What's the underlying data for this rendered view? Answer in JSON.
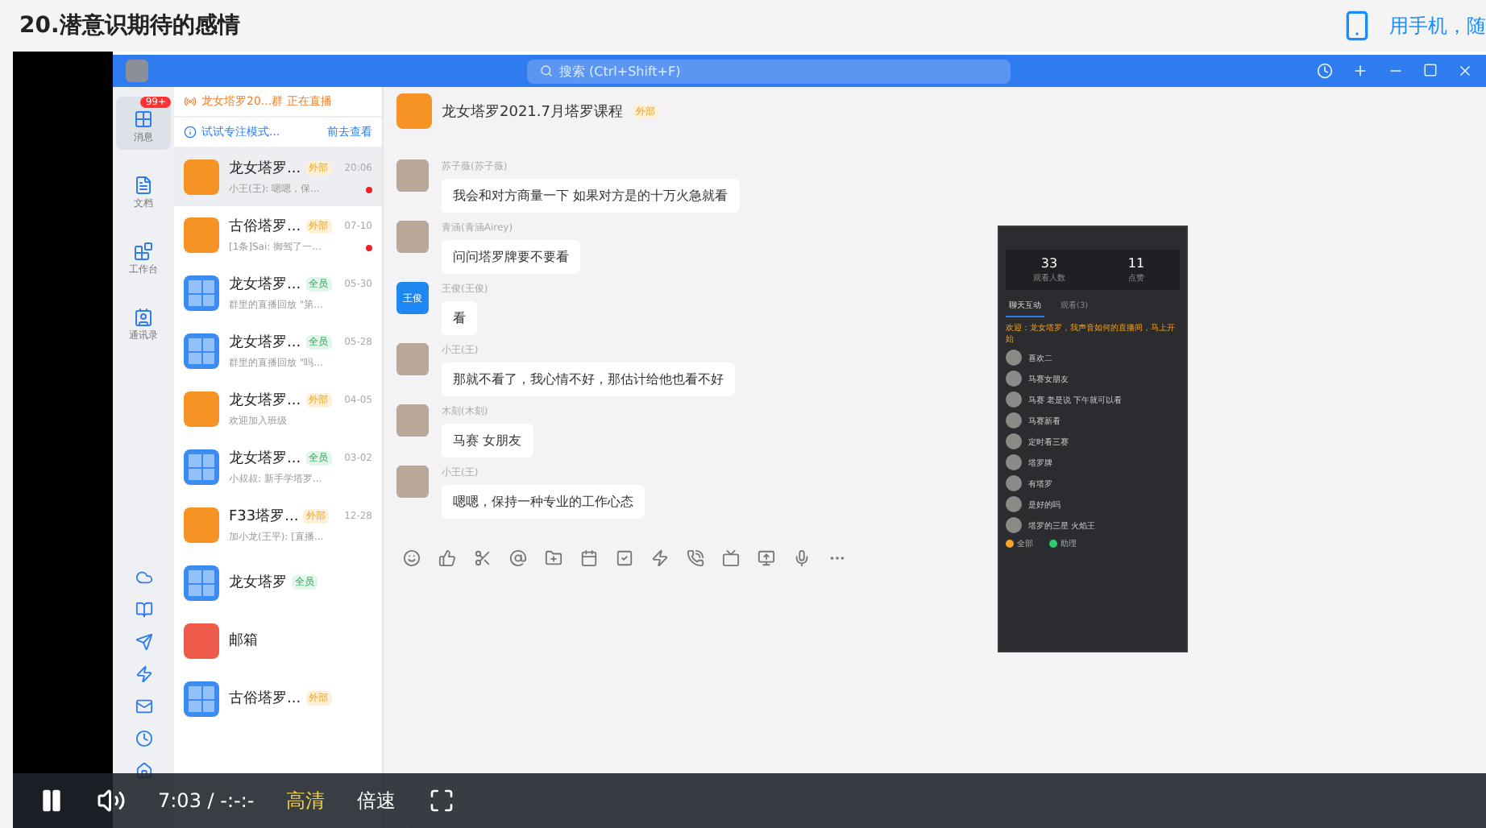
{
  "page_title": "20.潜意识期待的感情",
  "mobile_hint": "用手机，随",
  "app": {
    "search_placeholder": "搜索 (Ctrl+Shift+F)",
    "rail": [
      {
        "label": "消息",
        "badge": "99+",
        "selected": true
      },
      {
        "label": "文档",
        "selected": false
      },
      {
        "label": "工作台",
        "selected": false
      },
      {
        "label": "通讯录",
        "selected": false
      }
    ],
    "banners": [
      {
        "kind": "live",
        "text": "龙女塔罗20...群 正在直播"
      },
      {
        "kind": "info",
        "text": "试试专注模式...",
        "action": "前去查看"
      }
    ],
    "conversations": [
      {
        "kind": "live",
        "name": "龙女塔罗...",
        "tag": {
          "text": "外部",
          "kind": "external"
        },
        "time": "20:06",
        "preview": "小王(王): 嗯嗯，保...",
        "unread": true,
        "selected": true
      },
      {
        "kind": "live",
        "name": "古俗塔罗...",
        "tag": {
          "text": "外部",
          "kind": "external"
        },
        "time": "07-10",
        "preview": "[1条]Sai: 御驾了一...",
        "unread": true,
        "selected": false
      },
      {
        "kind": "grid",
        "name": "龙女塔罗...",
        "tag": {
          "text": "全员",
          "kind": "all"
        },
        "time": "05-30",
        "preview": "群里的直播回放 \"第...",
        "unread": false,
        "selected": false
      },
      {
        "kind": "grid",
        "name": "龙女塔罗...",
        "tag": {
          "text": "全员",
          "kind": "all"
        },
        "time": "05-28",
        "preview": "群里的直播回放 \"吗...",
        "unread": false,
        "selected": false
      },
      {
        "kind": "live",
        "name": "龙女塔罗...",
        "tag": {
          "text": "外部",
          "kind": "external"
        },
        "time": "04-05",
        "preview": "欢迎加入班级",
        "unread": false,
        "selected": false
      },
      {
        "kind": "grid",
        "name": "龙女塔罗...",
        "tag": {
          "text": "全员",
          "kind": "all"
        },
        "time": "03-02",
        "preview": "小叔叔: 新手学塔罗...",
        "unread": false,
        "selected": false
      },
      {
        "kind": "live",
        "name": "F33塔罗...",
        "tag": {
          "text": "外部",
          "kind": "external"
        },
        "time": "12-28",
        "preview": "加小龙(王平): [直播...",
        "unread": false,
        "selected": false
      },
      {
        "kind": "grid",
        "name": "龙女塔罗",
        "tag": {
          "text": "全员",
          "kind": "all"
        },
        "unread": false,
        "selected": false
      },
      {
        "kind": "mail",
        "name": "邮箱",
        "unread": false,
        "selected": false
      },
      {
        "kind": "grid",
        "name": "古俗塔罗...",
        "tag": {
          "text": "外部",
          "kind": "external"
        },
        "unread": false,
        "selected": false
      }
    ],
    "chat": {
      "title": "龙女塔罗2021.7月塔罗课程",
      "tag": "外部",
      "messages": [
        {
          "kind": "photo",
          "sender": "苏子薇(苏子薇)",
          "text": "我会和对方商量一下 如果对方是的十万火急就看"
        },
        {
          "kind": "photo",
          "sender": "青涵(青涵Airey)",
          "text": "问问塔罗牌要不要看"
        },
        {
          "kind": "initials",
          "sender": "王俊(王俊)",
          "text": "看",
          "initials": "王俊"
        },
        {
          "kind": "photo",
          "sender": "小王(王)",
          "text": "那就不看了，我心情不好，那估计给他也看不好"
        },
        {
          "kind": "photo",
          "sender": "木刻(木刻)",
          "text": "马赛 女朋友"
        },
        {
          "kind": "photo",
          "sender": "小王(王)",
          "text": "嗯嗯，保持一种专业的工作心态"
        }
      ]
    },
    "live_panel": {
      "stats": [
        {
          "value": "33",
          "label": "观看人数"
        },
        {
          "value": "11",
          "label": "点赞"
        }
      ],
      "tabs": [
        {
          "label": "聊天互动",
          "selected": true
        },
        {
          "label": "观看(3)",
          "selected": false
        }
      ],
      "notice": "欢迎：龙女塔罗，我声音如何的直播间，马上开始",
      "comments": [
        {
          "text": "喜欢二"
        },
        {
          "text": "马赛女朋友"
        },
        {
          "text": "马赛 老是说 下午就可以看"
        },
        {
          "text": "马赛新看"
        },
        {
          "text": "定时看三赛"
        },
        {
          "text": "塔罗牌"
        },
        {
          "text": "有塔罗"
        },
        {
          "text": "是好的吗"
        },
        {
          "text": "塔罗的三星 火焰王"
        }
      ],
      "filters": [
        {
          "label": "全部",
          "color": "#f5a623"
        },
        {
          "label": "助理",
          "color": "#2ecc71"
        }
      ]
    }
  },
  "player": {
    "playing": true,
    "time": "7:03 / -:-:-",
    "quality": "高清",
    "speed": "倍速"
  }
}
